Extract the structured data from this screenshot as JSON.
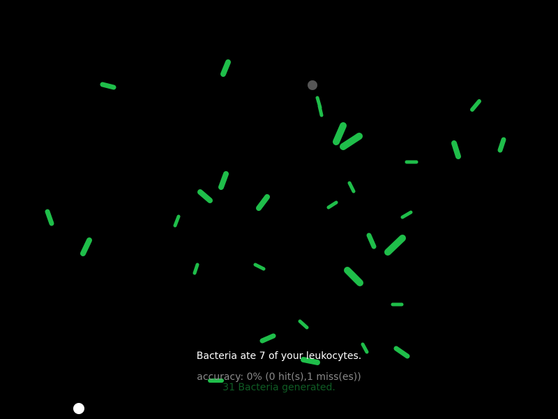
{
  "messages": {
    "main": "Bacteria ate 7 of your leukocytes.",
    "accuracy": "accuracy: 0% (0 hit(s),1 miss(es))",
    "generated": "31 Bacteria generated."
  },
  "colors": {
    "background": "#000000",
    "bacteria": "#1fbe4a",
    "main_text": "#ffffff",
    "accuracy_text": "#8a8a8a",
    "generated_text": "#0f5c24",
    "leukocyte": "#ffffff",
    "target_marker": "#555555"
  },
  "game_state": {
    "leukocytes_eaten": 7,
    "accuracy_percent": 0,
    "hits": 0,
    "misses": 1,
    "bacteria_generated": 31
  }
}
